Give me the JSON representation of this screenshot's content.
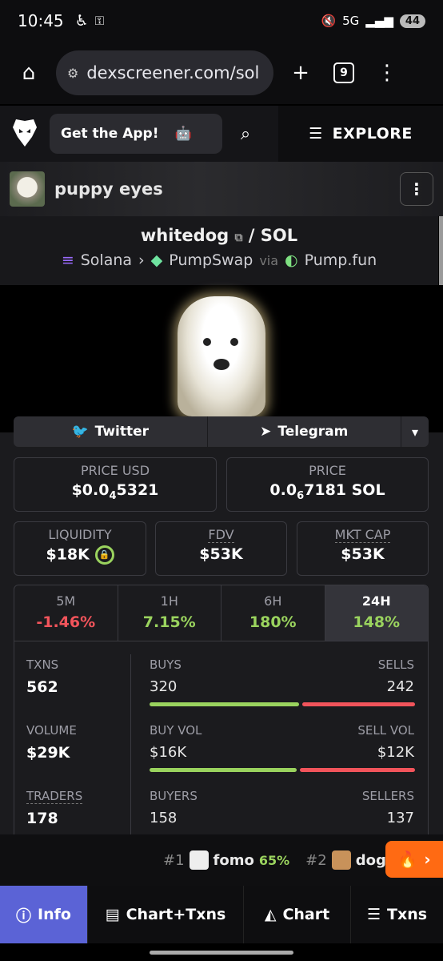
{
  "status": {
    "time": "10:45",
    "network": "5G",
    "battery": "44"
  },
  "browser": {
    "url": "dexscreener.com/sol",
    "tab_count": "9"
  },
  "header": {
    "get_app": "Get the App!",
    "explore": "EXPLORE"
  },
  "token": {
    "name": "puppy eyes"
  },
  "pair": {
    "base": "whitedog",
    "separator": "/",
    "quote": "SOL",
    "chain": "Solana",
    "dex": "PumpSwap",
    "via": "via",
    "launchpad": "Pump.fun"
  },
  "socials": {
    "twitter": "Twitter",
    "telegram": "Telegram"
  },
  "price_usd": {
    "label": "PRICE USD",
    "prefix": "$0.0",
    "sub": "4",
    "suffix": "5321"
  },
  "price_native": {
    "label": "PRICE",
    "prefix": "0.0",
    "sub": "6",
    "suffix": "7181 SOL"
  },
  "liquidity": {
    "label": "LIQUIDITY",
    "value": "$18K"
  },
  "fdv": {
    "label": "FDV",
    "value": "$53K"
  },
  "mkt_cap": {
    "label": "MKT CAP",
    "value": "$53K"
  },
  "periods": [
    {
      "label": "5M",
      "value": "-1.46%"
    },
    {
      "label": "1H",
      "value": "7.15%"
    },
    {
      "label": "6H",
      "value": "180%"
    },
    {
      "label": "24H",
      "value": "148%"
    }
  ],
  "stats": {
    "txns": {
      "label": "TXNS",
      "value": "562"
    },
    "volume": {
      "label": "VOLUME",
      "value": "$29K"
    },
    "traders": {
      "label": "TRADERS",
      "value": "178"
    },
    "buys": {
      "label": "BUYS",
      "value": "320",
      "ratio": 0.57
    },
    "sells": {
      "label": "SELLS",
      "value": "242"
    },
    "buy_vol": {
      "label": "BUY VOL",
      "value": "$16K",
      "ratio": 0.56
    },
    "sell_vol": {
      "label": "SELL VOL",
      "value": "$12K"
    },
    "buyers": {
      "label": "BUYERS",
      "value": "158"
    },
    "sellers": {
      "label": "SELLERS",
      "value": "137"
    }
  },
  "trending": [
    {
      "rank": "#1",
      "name": "fomo",
      "change": "65%"
    },
    {
      "rank": "#2",
      "name": "dogi"
    }
  ],
  "nav": {
    "info": "Info",
    "chart_txns": "Chart+Txns",
    "chart": "Chart",
    "txns": "Txns"
  },
  "colors": {
    "positive": "#9ad35e",
    "negative": "#f2545b",
    "active_tab": "#5b63d6",
    "hot": "#ff6a13"
  }
}
